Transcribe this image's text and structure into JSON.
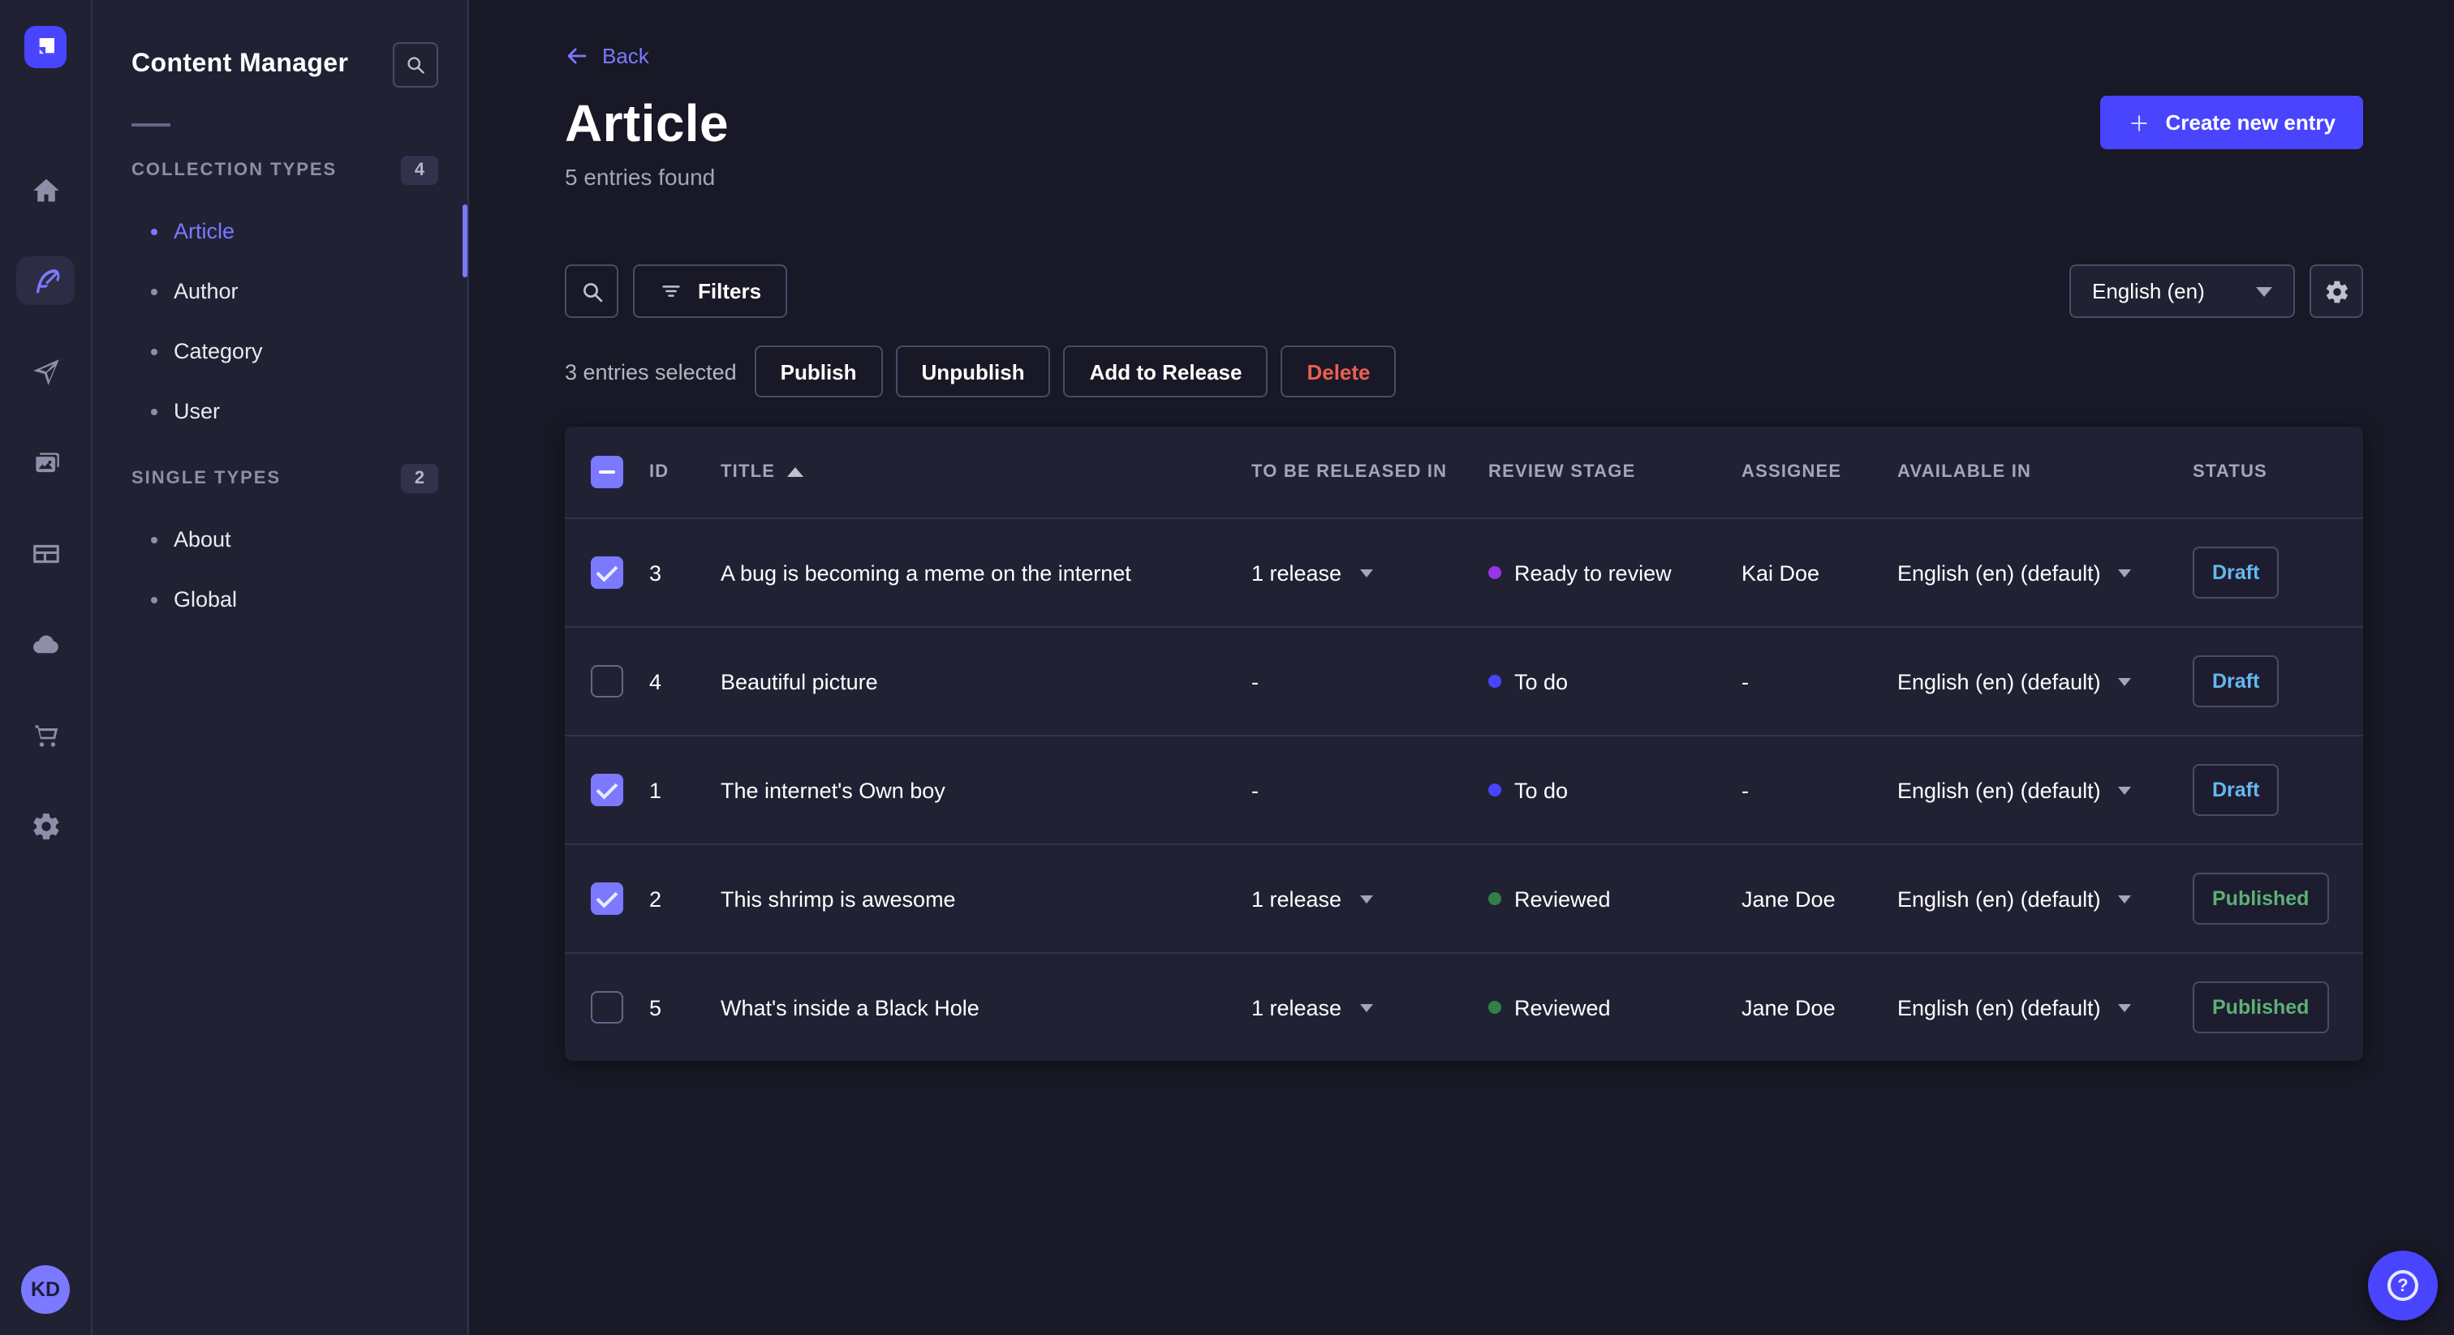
{
  "rail": {
    "icons": [
      {
        "name": "home",
        "active": false
      },
      {
        "name": "content-manager",
        "active": true
      },
      {
        "name": "releases",
        "active": false
      },
      {
        "name": "media-library",
        "active": false
      },
      {
        "name": "content-type-builder",
        "active": false
      },
      {
        "name": "deploy",
        "active": false
      },
      {
        "name": "marketplace",
        "active": false
      },
      {
        "name": "settings",
        "active": false
      }
    ],
    "avatar_initials": "KD"
  },
  "sidebar": {
    "title": "Content Manager",
    "sections": [
      {
        "label": "COLLECTION TYPES",
        "badge": "4",
        "items": [
          {
            "label": "Article",
            "active": true
          },
          {
            "label": "Author",
            "active": false
          },
          {
            "label": "Category",
            "active": false
          },
          {
            "label": "User",
            "active": false
          }
        ]
      },
      {
        "label": "SINGLE TYPES",
        "badge": "2",
        "items": [
          {
            "label": "About",
            "active": false
          },
          {
            "label": "Global",
            "active": false
          }
        ]
      }
    ]
  },
  "header": {
    "back_label": "Back",
    "title": "Article",
    "subtitle": "5 entries found",
    "create_button_label": "Create new entry"
  },
  "toolbar": {
    "filters_label": "Filters",
    "locale_selected": "English (en)"
  },
  "selection_bar": {
    "text": "3 entries selected",
    "publish_label": "Publish",
    "unpublish_label": "Unpublish",
    "add_to_release_label": "Add to Release",
    "delete_label": "Delete"
  },
  "table": {
    "headers": {
      "id": "ID",
      "title": "TITLE",
      "to_be_released_in": "TO BE RELEASED IN",
      "review_stage": "REVIEW STAGE",
      "assignee": "ASSIGNEE",
      "available_in": "AVAILABLE IN",
      "status": "STATUS"
    },
    "sort": {
      "column": "TITLE",
      "direction": "asc"
    },
    "rows": [
      {
        "selected": true,
        "id": "3",
        "title": "A bug is becoming a meme on the internet",
        "release": "1 release",
        "stage": {
          "label": "Ready to review",
          "color": "#9736e8"
        },
        "assignee": "Kai Doe",
        "locale": "English (en) (default)",
        "status": {
          "label": "Draft",
          "color": "#66b7f1"
        }
      },
      {
        "selected": false,
        "id": "4",
        "title": "Beautiful picture",
        "release": "-",
        "stage": {
          "label": "To do",
          "color": "#4945ff"
        },
        "assignee": "-",
        "locale": "English (en) (default)",
        "status": {
          "label": "Draft",
          "color": "#66b7f1"
        }
      },
      {
        "selected": true,
        "id": "1",
        "title": "The internet's Own boy",
        "release": "-",
        "stage": {
          "label": "To do",
          "color": "#4945ff"
        },
        "assignee": "-",
        "locale": "English (en) (default)",
        "status": {
          "label": "Draft",
          "color": "#66b7f1"
        }
      },
      {
        "selected": true,
        "id": "2",
        "title": "This shrimp is awesome",
        "release": "1 release",
        "stage": {
          "label": "Reviewed",
          "color": "#328048"
        },
        "assignee": "Jane Doe",
        "locale": "English (en) (default)",
        "status": {
          "label": "Published",
          "color": "#5cb176"
        }
      },
      {
        "selected": false,
        "id": "5",
        "title": "What's inside a Black Hole",
        "release": "1 release",
        "stage": {
          "label": "Reviewed",
          "color": "#328048"
        },
        "assignee": "Jane Doe",
        "locale": "English (en) (default)",
        "status": {
          "label": "Published",
          "color": "#5cb176"
        }
      }
    ]
  },
  "colors": {
    "primary": "#4945ff",
    "primary_light": "#7b79ff",
    "danger": "#ee5e52",
    "draft": "#66b7f1",
    "published": "#5cb176"
  },
  "help": {
    "icon": "question-mark"
  }
}
